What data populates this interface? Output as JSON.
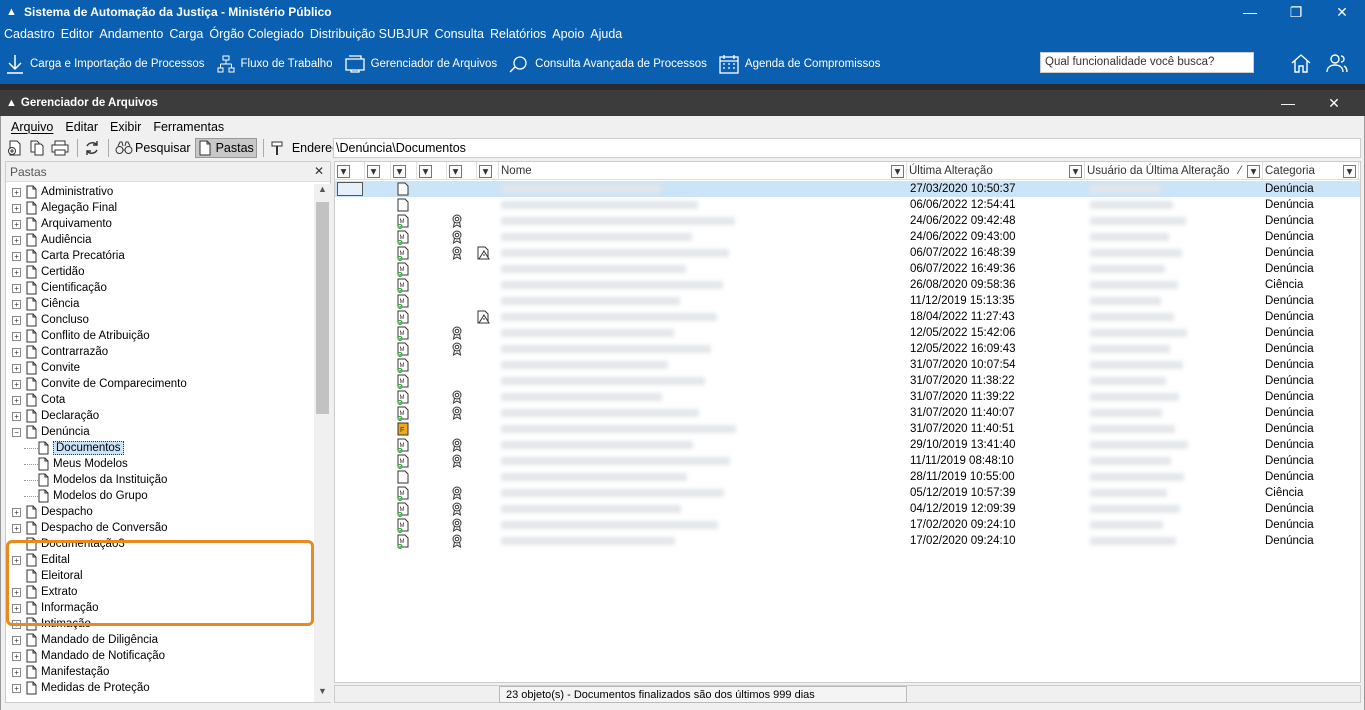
{
  "window": {
    "title": "Sistema de Automação da Justiça - Ministério Público"
  },
  "menu": [
    "Cadastro",
    "Editor",
    "Andamento",
    "Carga",
    "Órgão Colegiado",
    "Distribuição SUBJUR",
    "Consulta",
    "Relatórios",
    "Apoio",
    "Ajuda"
  ],
  "toolbar": {
    "items": [
      "Carga e Importação de Processos",
      "Fluxo de Trabalho",
      "Gerenciador de Arquivos",
      "Consulta Avançada de Processos",
      "Agenda de Compromissos"
    ],
    "search_placeholder": "Qual funcionalidade você busca?"
  },
  "child_window": {
    "title": "Gerenciador de Arquivos"
  },
  "inner_menu": [
    "Arquivo",
    "Editar",
    "Exibir",
    "Ferramentas"
  ],
  "inner_toolbar": {
    "search_label": "Pesquisar",
    "folders_label": "Pastas",
    "address_label": "Endereço",
    "address_value": "\\Denúncia\\Documentos"
  },
  "folders": {
    "header": "Pastas",
    "items": [
      "Administrativo",
      "Alegação Final",
      "Arquivamento",
      "Audiência",
      "Carta Precatória",
      "Certidão",
      "Cientificação",
      "Ciência",
      "Concluso",
      "Conflito de Atribuição",
      "Contrarrazão",
      "Convite",
      "Convite de Comparecimento",
      "Cota",
      "Declaração",
      "Denúncia",
      "Documentos",
      "Meus Modelos",
      "Modelos da Instituição",
      "Modelos do Grupo",
      "Despacho",
      "Despacho de Conversão",
      "Documentação3",
      "Edital",
      "Eleitoral",
      "Extrato",
      "Informação",
      "Intimação",
      "Mandado de Diligência",
      "Mandado de Notificação",
      "Manifestação",
      "Medidas de Proteção"
    ]
  },
  "grid": {
    "columns": {
      "name": "Nome",
      "last_change": "Última Alteração",
      "user": "Usuário da Última Alteração",
      "category": "Categoria"
    },
    "rows": [
      {
        "date": "27/03/2020 10:50:37",
        "cat": "Denúncia"
      },
      {
        "date": "06/06/2022 12:54:41",
        "cat": "Denúncia"
      },
      {
        "date": "24/06/2022 09:42:48",
        "cat": "Denúncia"
      },
      {
        "date": "24/06/2022 09:43:00",
        "cat": "Denúncia"
      },
      {
        "date": "06/07/2022 16:48:39",
        "cat": "Denúncia"
      },
      {
        "date": "06/07/2022 16:49:36",
        "cat": "Denúncia"
      },
      {
        "date": "26/08/2020 09:58:36",
        "cat": "Ciência"
      },
      {
        "date": "11/12/2019 15:13:35",
        "cat": "Denúncia"
      },
      {
        "date": "18/04/2022 11:27:43",
        "cat": "Denúncia"
      },
      {
        "date": "12/05/2022 15:42:06",
        "cat": "Denúncia"
      },
      {
        "date": "12/05/2022 16:09:43",
        "cat": "Denúncia"
      },
      {
        "date": "31/07/2020 10:07:54",
        "cat": "Denúncia"
      },
      {
        "date": "31/07/2020 11:38:22",
        "cat": "Denúncia"
      },
      {
        "date": "31/07/2020 11:39:22",
        "cat": "Denúncia"
      },
      {
        "date": "31/07/2020 11:40:07",
        "cat": "Denúncia"
      },
      {
        "date": "31/07/2020 11:40:51",
        "cat": "Denúncia"
      },
      {
        "date": "29/10/2019 13:41:40",
        "cat": "Denúncia"
      },
      {
        "date": "11/11/2019 08:48:10",
        "cat": "Denúncia"
      },
      {
        "date": "28/11/2019 10:55:00",
        "cat": "Denúncia"
      },
      {
        "date": "05/12/2019 10:57:39",
        "cat": "Ciência"
      },
      {
        "date": "04/12/2019 12:09:39",
        "cat": "Denúncia"
      },
      {
        "date": "17/02/2020 09:24:10",
        "cat": "Denúncia"
      },
      {
        "date": "17/02/2020 09:24:10",
        "cat": "Denúncia"
      }
    ]
  },
  "status": {
    "message": "23 objeto(s) - Documentos finalizados são dos últimos 999 dias"
  }
}
